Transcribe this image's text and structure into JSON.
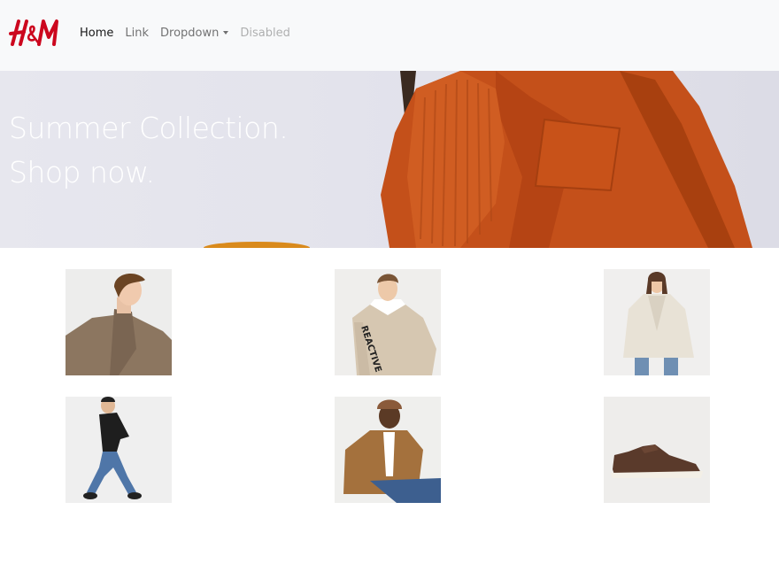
{
  "brand": {
    "logo_text": "H&M",
    "logo_color": "#cc071e"
  },
  "nav": {
    "items": [
      {
        "label": "Home",
        "state": "active"
      },
      {
        "label": "Link",
        "state": "normal"
      },
      {
        "label": "Dropdown",
        "state": "dropdown"
      },
      {
        "label": "Disabled",
        "state": "disabled"
      }
    ]
  },
  "hero": {
    "line1": "Summer Collection.",
    "line2": "Shop now."
  },
  "products": [
    {
      "image": "man-brown-coat-photo"
    },
    {
      "image": "man-beige-hoodie-reactive-photo"
    },
    {
      "image": "woman-cream-teddy-coat-photo"
    },
    {
      "image": "man-black-tee-jeans-photo"
    },
    {
      "image": "man-tan-shirt-beanie-photo"
    },
    {
      "image": "brown-sneaker-photo"
    }
  ],
  "colors": {
    "navbar_bg": "#f8f9fa",
    "coat_orange": "#c4501a"
  }
}
